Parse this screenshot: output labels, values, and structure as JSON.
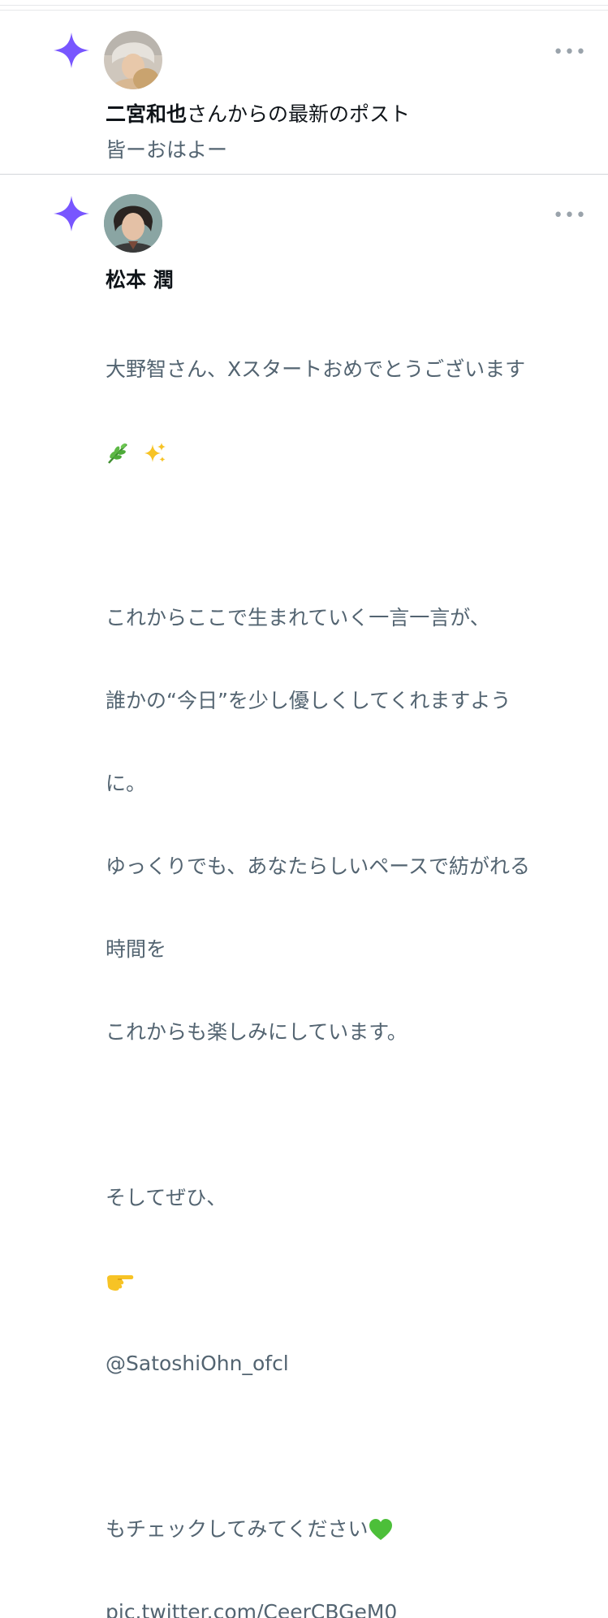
{
  "notifications": [
    {
      "type": "latest-post",
      "name": "二宮和也",
      "title_suffix": "さんからの最新のポスト",
      "preview": "皆ーおはよー",
      "more": "•••",
      "accent": "#7856ff"
    },
    {
      "type": "post",
      "name": "松本 潤",
      "more": "•••",
      "accent": "#7856ff",
      "lines": [
        "大野智さん、Xスタートおめでとうございます",
        "",
        "",
        "これからここで生まれていく一言一言が、",
        "誰かの“今日”を少し優しくしてくれますよう",
        "に。",
        "ゆっくりでも、あなたらしいペースで紡がれる",
        "時間を",
        "これからも楽しみにしています。",
        "",
        "そしてぜひ、",
        "",
        "@SatoshiOhn_ofcl",
        "",
        " もチェックしてみてください",
        "pic.twitter.com/CeerCBGeM0"
      ],
      "emoji": {
        "herb": "herb-emoji",
        "sparkles": "sparkles-emoji",
        "pointing_right": "pointing-hand-emoji",
        "green_heart": "green-heart-emoji"
      }
    }
  ]
}
